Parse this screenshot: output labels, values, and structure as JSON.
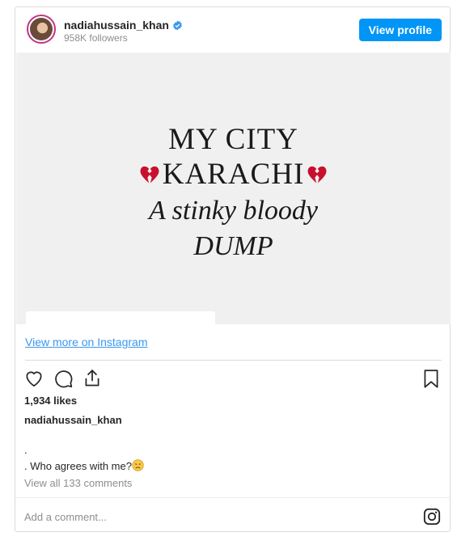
{
  "header": {
    "username": "nadiahussain_khan",
    "followers": "958K followers",
    "view_profile_label": "View profile"
  },
  "post": {
    "line1": "MY CITY",
    "line2": "KARACHI",
    "line3": "A stinky bloody",
    "line4": "DUMP",
    "heart_icon": "broken-heart-icon"
  },
  "view_more_label": "View more on Instagram",
  "likes": "1,934 likes",
  "owner": "nadiahussain_khan",
  "caption": {
    "line1": ".",
    "line2": ". Who agrees with me?",
    "emoji": "disappointed-face-icon"
  },
  "view_comments": "View all 133 comments",
  "add_comment_placeholder": "Add a comment...",
  "colors": {
    "accent": "#0095f6",
    "link": "#3897f0",
    "muted": "#8e8e8e",
    "border": "#dbdbdb",
    "media_bg": "#f0f0f0"
  },
  "icons": [
    "like-icon",
    "comment-icon",
    "share-icon",
    "save-icon",
    "instagram-icon",
    "verified-badge-icon"
  ]
}
